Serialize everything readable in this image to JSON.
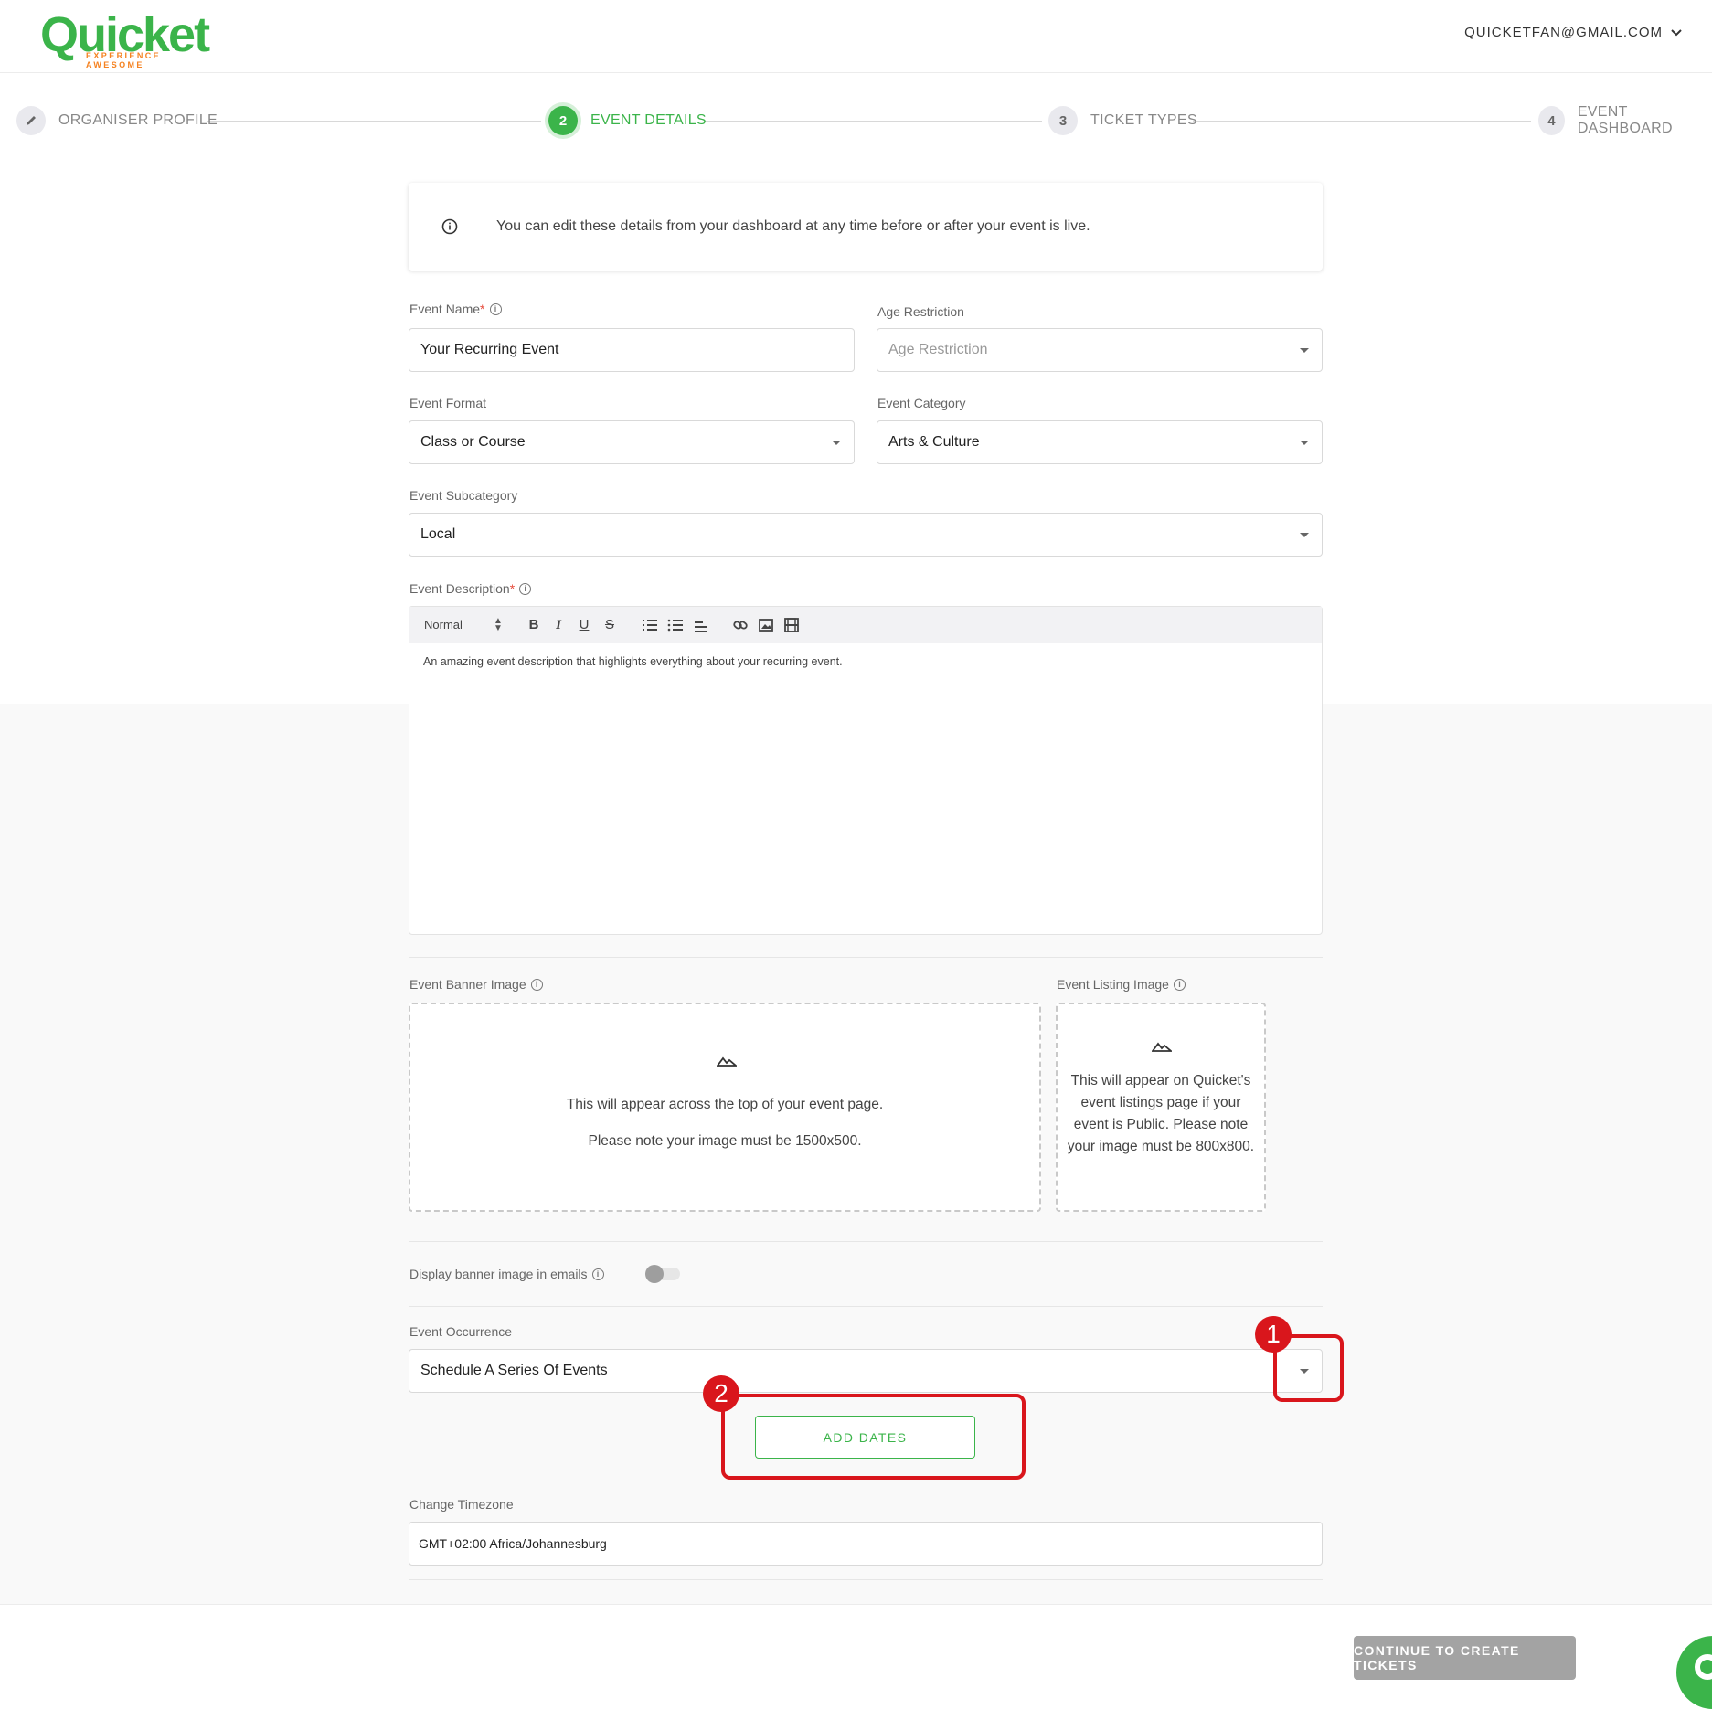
{
  "header": {
    "logo_word": "Quicket",
    "logo_tagline": "EXPERIENCE AWESOME",
    "user_email": "QUICKETFAN@GMAIL.COM"
  },
  "stepper": {
    "steps": [
      {
        "number": "",
        "label": "ORGANISER PROFILE",
        "state": "done"
      },
      {
        "number": "2",
        "label": "EVENT DETAILS",
        "state": "active"
      },
      {
        "number": "3",
        "label": "TICKET TYPES",
        "state": "pending"
      },
      {
        "number": "4",
        "label": "EVENT DASHBOARD",
        "state": "pending"
      }
    ]
  },
  "info_banner": {
    "text": "You can edit these details from your dashboard at any time before or after your event is live."
  },
  "form": {
    "event_name": {
      "label": "Event Name",
      "required": "*",
      "value": "Your Recurring Event"
    },
    "age_restriction": {
      "label": "Age Restriction",
      "placeholder": "Age Restriction"
    },
    "event_format": {
      "label": "Event Format",
      "value": "Class or Course"
    },
    "event_category": {
      "label": "Event Category",
      "value": "Arts & Culture"
    },
    "event_subcategory": {
      "label": "Event Subcategory",
      "value": "Local"
    },
    "event_description": {
      "label": "Event Description",
      "required": "*",
      "toolbar_format": "Normal",
      "text": "An amazing event description that highlights everything about your recurring event."
    },
    "banner_image": {
      "label": "Event Banner Image",
      "line1": "This will appear across the top of your event page.",
      "line2": "Please note your image must be 1500x500."
    },
    "listing_image": {
      "label": "Event Listing Image",
      "text": "This will appear on Quicket's event listings page if your event is Public. Please note your image must be 800x800."
    },
    "display_banner_toggle": {
      "label": "Display banner image in emails",
      "on": false
    },
    "event_occurrence": {
      "label": "Event Occurrence",
      "value": "Schedule A Series Of Events"
    },
    "add_dates_label": "ADD DATES",
    "timezone": {
      "label": "Change Timezone",
      "value": "GMT+02:00 Africa/Johannesburg"
    }
  },
  "annotations": [
    {
      "number": "1"
    },
    {
      "number": "2"
    }
  ],
  "footer": {
    "continue_label": "CONTINUE TO CREATE TICKETS"
  },
  "colors": {
    "brand_green": "#3bb44a",
    "brand_orange": "#f58220",
    "annotation_red": "#d9161c",
    "disabled_grey": "#a3a3a3"
  }
}
